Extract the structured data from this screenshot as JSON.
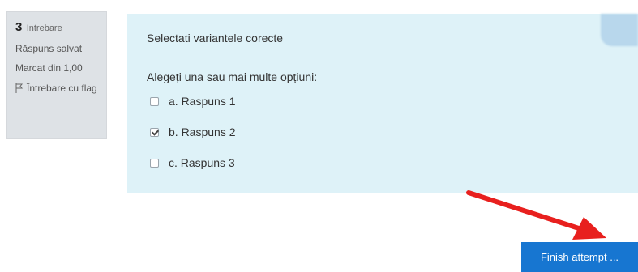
{
  "question_info": {
    "number": "3",
    "word": "Intrebare",
    "status": "Răspuns salvat",
    "mark": "Marcat din 1,00",
    "flag_label": "Întrebare cu flag",
    "flag_icon": "flag-icon"
  },
  "question": {
    "text": "Selectati variantele corecte",
    "prompt": "Alegeți una sau mai multe opțiuni:",
    "answers": [
      {
        "label": "a. Raspuns 1",
        "checked": false
      },
      {
        "label": "b. Raspuns 2",
        "checked": true
      },
      {
        "label": "c. Raspuns 3",
        "checked": false
      }
    ]
  },
  "footer": {
    "finish_label": "Finish attempt ..."
  },
  "colors": {
    "content_bg": "#def2f8",
    "info_bg": "#dee2e6",
    "button_bg": "#1776d1",
    "arrow": "#e8201e"
  }
}
